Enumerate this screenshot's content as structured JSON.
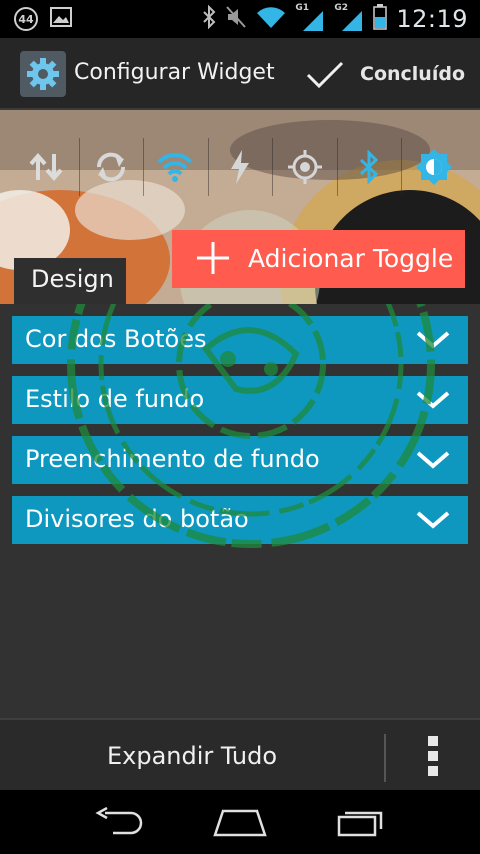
{
  "status_bar": {
    "notification_count": "44",
    "sim1_label": "G1",
    "sim2_label": "G2",
    "time": "12:19",
    "icons": [
      "gallery-icon",
      "bluetooth-icon",
      "mute-icon",
      "wifi-icon",
      "signal-icon",
      "battery-icon"
    ]
  },
  "action_bar": {
    "title": "Configurar Widget",
    "done_label": "Concluído",
    "icons": [
      "settings-gear-icon",
      "checkmark-icon"
    ]
  },
  "preview": {
    "toggles": [
      {
        "name": "data-toggle",
        "icon": "data-arrows-icon"
      },
      {
        "name": "sync-toggle",
        "icon": "sync-icon"
      },
      {
        "name": "wifi-toggle",
        "icon": "wifi-icon"
      },
      {
        "name": "flash-toggle",
        "icon": "flash-icon"
      },
      {
        "name": "gps-toggle",
        "icon": "gps-icon"
      },
      {
        "name": "bluetooth-toggle",
        "icon": "bluetooth-icon"
      },
      {
        "name": "brightness-toggle",
        "icon": "brightness-icon"
      }
    ],
    "add_toggle_label": "Adicionar Toggle",
    "design_tab_label": "Design"
  },
  "sections": [
    {
      "label": "Cor dos Botões"
    },
    {
      "label": "Estilo de fundo"
    },
    {
      "label": "Preenchimento de fundo"
    },
    {
      "label": "Divisores do botão"
    }
  ],
  "bottom_bar": {
    "expand_label": "Expandir Tudo"
  },
  "colors": {
    "accent_blue": "#0e98bf",
    "add_button": "#ff5b4f",
    "active_icon": "#33b5e5"
  }
}
